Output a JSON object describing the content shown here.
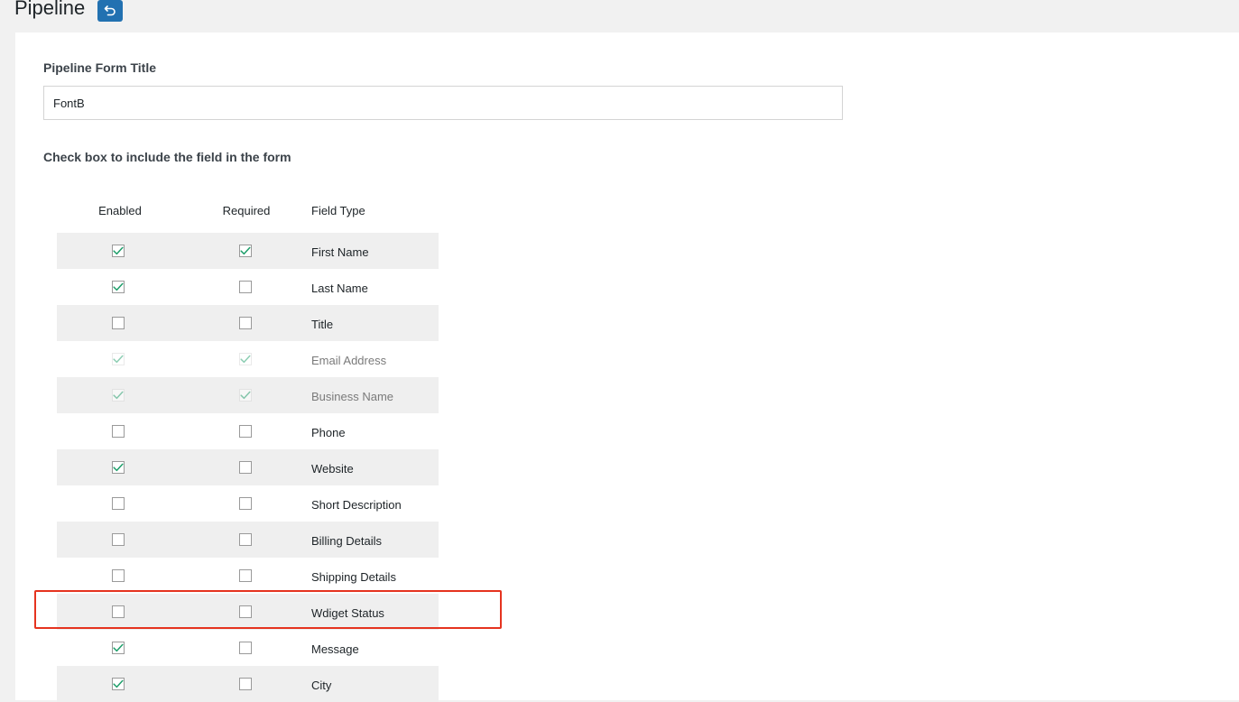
{
  "header": {
    "title": "Pipeline",
    "back_icon": "undo-arrow-icon",
    "accent_color": "#2271b1"
  },
  "form": {
    "title_label": "Pipeline Form Title",
    "title_value": "FontB",
    "section_heading": "Check box to include the field in the form"
  },
  "table": {
    "headers": {
      "enabled": "Enabled",
      "required": "Required",
      "field_type": "Field Type"
    },
    "check_color": "#1e9e6a",
    "rows": [
      {
        "field": "First Name",
        "enabled": true,
        "required": true,
        "disabled": false
      },
      {
        "field": "Last Name",
        "enabled": true,
        "required": false,
        "disabled": false
      },
      {
        "field": "Title",
        "enabled": false,
        "required": false,
        "disabled": false
      },
      {
        "field": "Email Address",
        "enabled": true,
        "required": true,
        "disabled": true
      },
      {
        "field": "Business Name",
        "enabled": true,
        "required": true,
        "disabled": true
      },
      {
        "field": "Phone",
        "enabled": false,
        "required": false,
        "disabled": false
      },
      {
        "field": "Website",
        "enabled": true,
        "required": false,
        "disabled": false
      },
      {
        "field": "Short Description",
        "enabled": false,
        "required": false,
        "disabled": false
      },
      {
        "field": "Billing Details",
        "enabled": false,
        "required": false,
        "disabled": false
      },
      {
        "field": "Shipping Details",
        "enabled": false,
        "required": false,
        "disabled": false
      },
      {
        "field": "Wdiget Status",
        "enabled": false,
        "required": false,
        "disabled": false,
        "highlighted": true
      },
      {
        "field": "Message",
        "enabled": true,
        "required": false,
        "disabled": false
      },
      {
        "field": "City",
        "enabled": true,
        "required": false,
        "disabled": false
      }
    ]
  },
  "highlight_color": "#e5331f"
}
